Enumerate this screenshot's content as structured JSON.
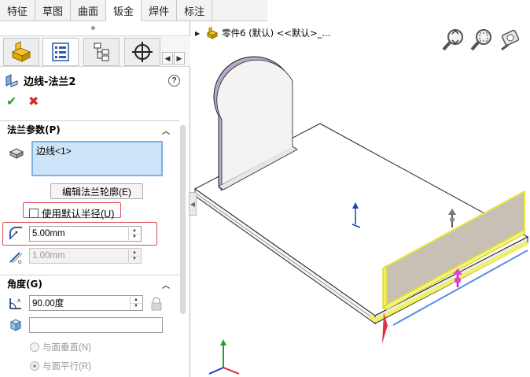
{
  "tabs": [
    "特征",
    "草图",
    "曲面",
    "钣金",
    "焊件",
    "标注"
  ],
  "active_tab": "钣金",
  "feature": {
    "title": "边线-法兰2"
  },
  "sections": {
    "flange_params": {
      "title": "法兰参数(P)",
      "edge_item": "边线<1>",
      "edit_profile": "编辑法兰轮廓(E)",
      "use_default_radius": "使用默认半径(U)",
      "radius": "5.00mm",
      "gap": "1.00mm"
    },
    "angle": {
      "title": "角度(G)",
      "angle_value": "90.00度",
      "reference_value": "",
      "radio_perpendicular": "与面垂直(N)",
      "radio_parallel": "与面平行(R)"
    }
  },
  "tree": {
    "part_label": "零件6 (默认) <<默认>_..."
  },
  "icons": [
    "part-icon",
    "feature-manager-icon",
    "property-manager-icon",
    "config-manager-icon",
    "dim-expert-icon",
    "sheetmetal-flange-icon",
    "help-icon",
    "ok-icon",
    "cancel-icon",
    "edge-select-icon",
    "radius-icon",
    "gap-icon",
    "angle-icon",
    "face-select-icon",
    "lock-icon",
    "zoom-fit-icon",
    "zoom-area-icon",
    "previous-view-icon",
    "triad-icon"
  ],
  "colors": {
    "selection_blue": "#cde3f8",
    "highlight_red": "#e04a5d",
    "preview_yellow": "#f0f060",
    "flange_purple": "#b8a9c9",
    "ok_green": "#2e9b2e",
    "cancel_red": "#d12a2a"
  }
}
